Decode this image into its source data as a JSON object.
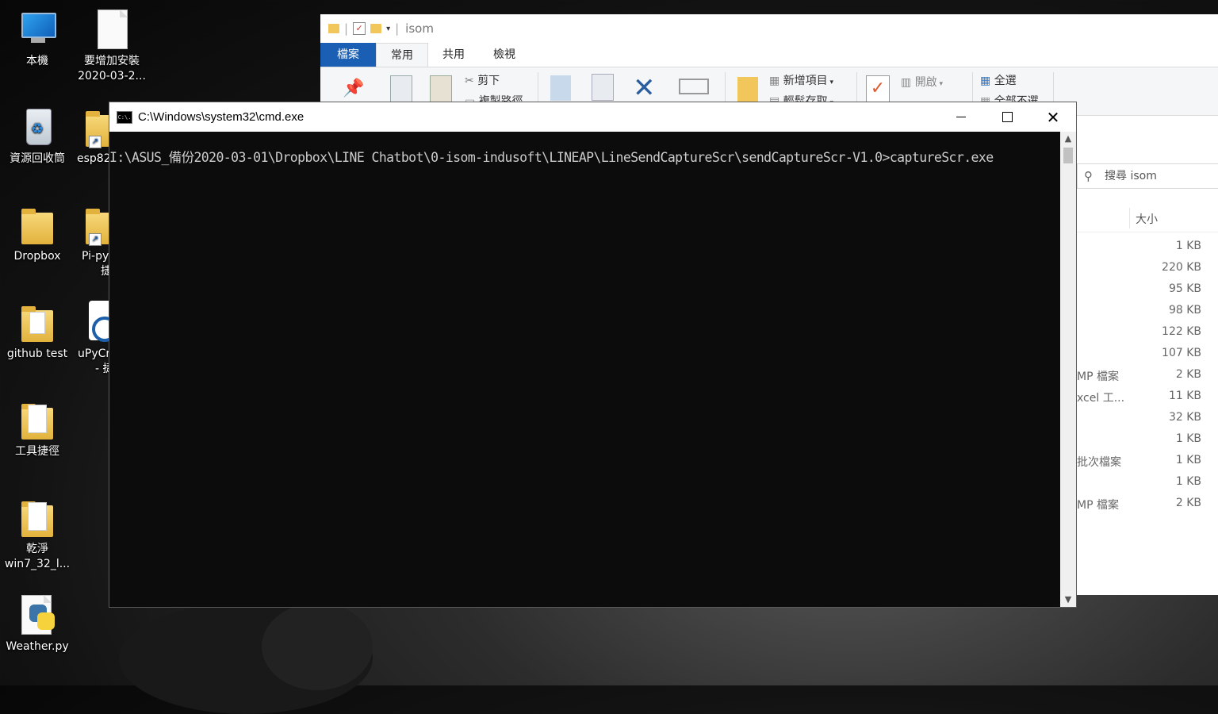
{
  "desktop": {
    "icons": [
      {
        "label": "本機"
      },
      {
        "label": "要增加安裝",
        "label2": "2020-03-2..."
      },
      {
        "label": "資源回收筒"
      },
      {
        "label": "esp82"
      },
      {
        "label": "Dropbox"
      },
      {
        "label": "Pi-py",
        "label2": "捷"
      },
      {
        "label": "github test"
      },
      {
        "label": "uPyCr",
        "label2": "- 捷"
      },
      {
        "label": "工具捷徑"
      },
      {
        "label": "乾淨",
        "label2": "win7_32_l..."
      },
      {
        "label": "Weather.py"
      }
    ]
  },
  "explorer": {
    "title": "isom",
    "tabs": [
      "檔案",
      "常用",
      "共用",
      "檢視"
    ],
    "ribbon": {
      "cut": "剪下",
      "copy_path": "複製路徑",
      "new_item": "新增項目",
      "easy_access": "輕鬆存取",
      "open": "開啟",
      "select_all": "全選",
      "select_none": "全部不選"
    },
    "search_placeholder": "搜尋 isom",
    "size_header": "大小",
    "rows": [
      {
        "type": "",
        "size": "1 KB"
      },
      {
        "type": "",
        "size": "220 KB"
      },
      {
        "type": "",
        "size": "95 KB"
      },
      {
        "type": "",
        "size": "98 KB"
      },
      {
        "type": "",
        "size": "122 KB"
      },
      {
        "type": "",
        "size": "107 KB"
      },
      {
        "type": "MP 檔案",
        "size": "2 KB"
      },
      {
        "type": "xcel 工...",
        "size": "11 KB"
      },
      {
        "type": "",
        "size": "32 KB"
      },
      {
        "type": "",
        "size": "1 KB"
      },
      {
        "type": "批次檔案",
        "size": "1 KB"
      },
      {
        "type": "",
        "size": "1 KB"
      },
      {
        "type": "MP 檔案",
        "size": "2 KB"
      }
    ]
  },
  "cmd": {
    "title": "C:\\Windows\\system32\\cmd.exe",
    "icon_text": "C:\\.",
    "line": "I:\\ASUS_備份2020-03-01\\Dropbox\\LINE Chatbot\\0-isom-indusoft\\LINEAP\\LineSendCaptureScr\\sendCaptureScr-V1.0>captureScr.exe"
  }
}
